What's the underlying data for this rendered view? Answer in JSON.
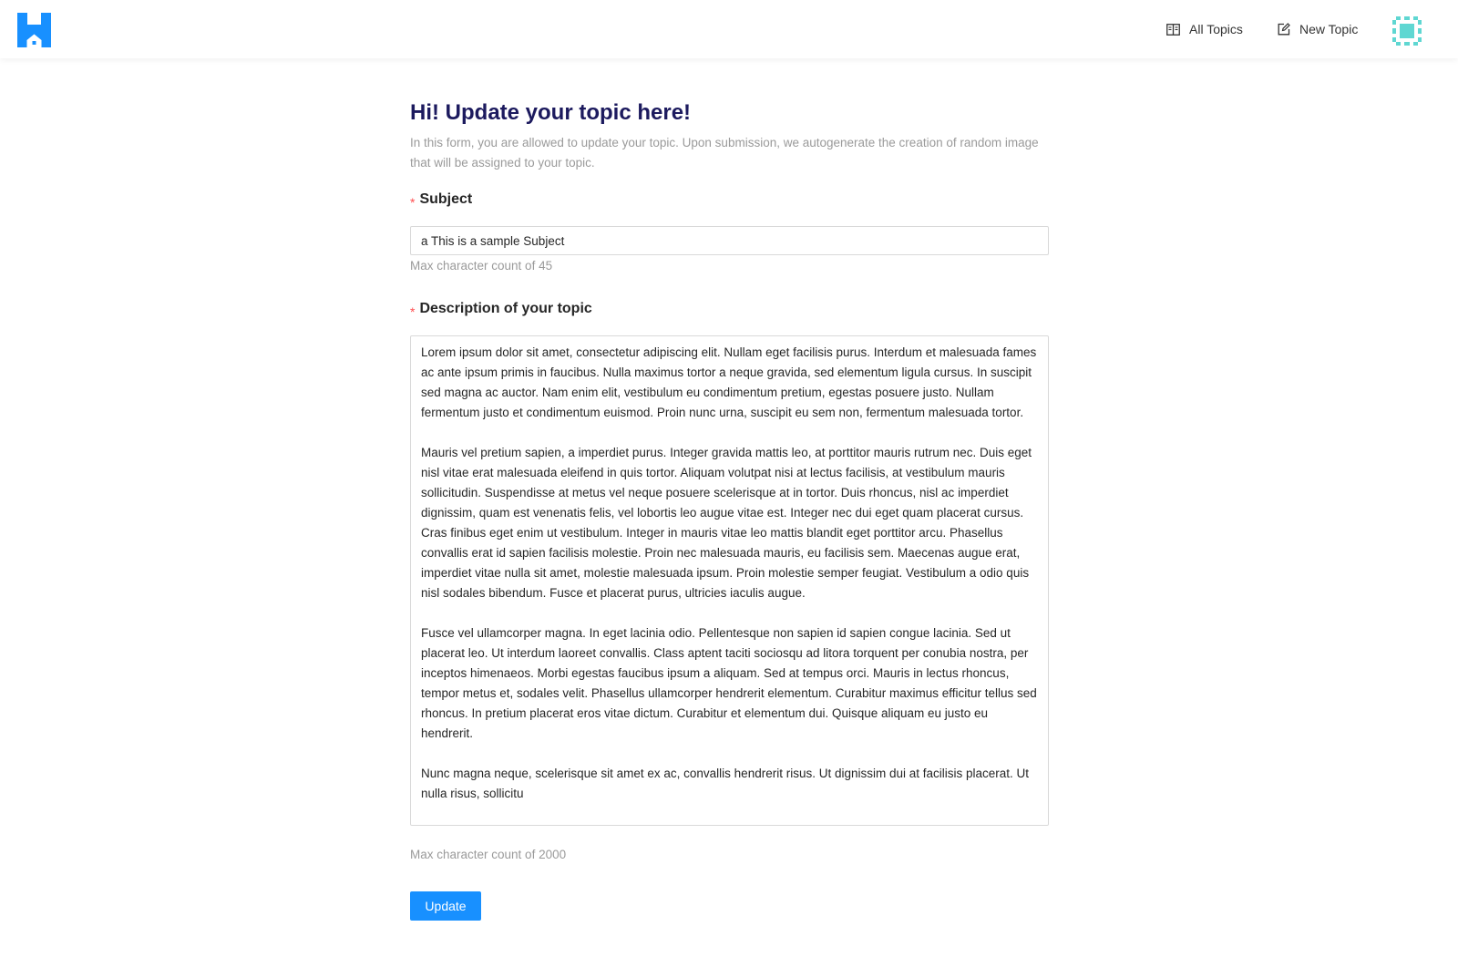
{
  "nav": {
    "logo_icon": "house-logo-icon",
    "items": [
      {
        "label": "All Topics",
        "icon": "book-icon"
      },
      {
        "label": "New Topic",
        "icon": "edit-icon"
      }
    ],
    "avatar_icon": "avatar-pattern-icon"
  },
  "form": {
    "title": "Hi! Update your topic here!",
    "description": "In this form, you are allowed to update your topic. Upon submission, we autogenerate the creation of random image that will be assigned to your topic.",
    "subject": {
      "label": "Subject",
      "value": "a This is a sample Subject",
      "hint": "Max character count of 45"
    },
    "topic_description": {
      "label": "Description of your topic",
      "value": "Lorem ipsum dolor sit amet, consectetur adipiscing elit. Nullam eget facilisis purus. Interdum et malesuada fames ac ante ipsum primis in faucibus. Nulla maximus tortor a neque gravida, sed elementum ligula cursus. In suscipit sed magna ac auctor. Nam enim elit, vestibulum eu condimentum pretium, egestas posuere justo. Nullam fermentum justo et condimentum euismod. Proin nunc urna, suscipit eu sem non, fermentum malesuada tortor.\n\nMauris vel pretium sapien, a imperdiet purus. Integer gravida mattis leo, at porttitor mauris rutrum nec. Duis eget nisl vitae erat malesuada eleifend in quis tortor. Aliquam volutpat nisi at lectus facilisis, at vestibulum mauris sollicitudin. Suspendisse at metus vel neque posuere scelerisque at in tortor. Duis rhoncus, nisl ac imperdiet dignissim, quam est venenatis felis, vel lobortis leo augue vitae est. Integer nec dui eget quam placerat cursus. Cras finibus eget enim ut vestibulum. Integer in mauris vitae leo mattis blandit eget porttitor arcu. Phasellus convallis erat id sapien facilisis molestie. Proin nec malesuada mauris, eu facilisis sem. Maecenas augue erat, imperdiet vitae nulla sit amet, molestie malesuada ipsum. Proin molestie semper feugiat. Vestibulum a odio quis nisl sodales bibendum. Fusce et placerat purus, ultricies iaculis augue.\n\nFusce vel ullamcorper magna. In eget lacinia odio. Pellentesque non sapien id sapien congue lacinia. Sed ut placerat leo. Ut interdum laoreet convallis. Class aptent taciti sociosqu ad litora torquent per conubia nostra, per inceptos himenaeos. Morbi egestas faucibus ipsum a aliquam. Sed at tempus orci. Mauris in lectus rhoncus, tempor metus et, sodales velit. Phasellus ullamcorper hendrerit elementum. Curabitur maximus efficitur tellus sed rhoncus. In pretium placerat eros vitae dictum. Curabitur et elementum dui. Quisque aliquam eu justo eu hendrerit.\n\nNunc magna neque, scelerisque sit amet ex ac, convallis hendrerit risus. Ut dignissim dui at facilisis placerat. Ut nulla risus, sollicitu",
      "hint": "Max character count of 2000"
    },
    "required_marker": "*",
    "submit_label": "Update"
  },
  "colors": {
    "primary": "#1890ff",
    "title": "#1c1a5e",
    "required": "#ff4d4f",
    "hint": "#9a9a9a",
    "avatar": "#5fd7d2"
  }
}
